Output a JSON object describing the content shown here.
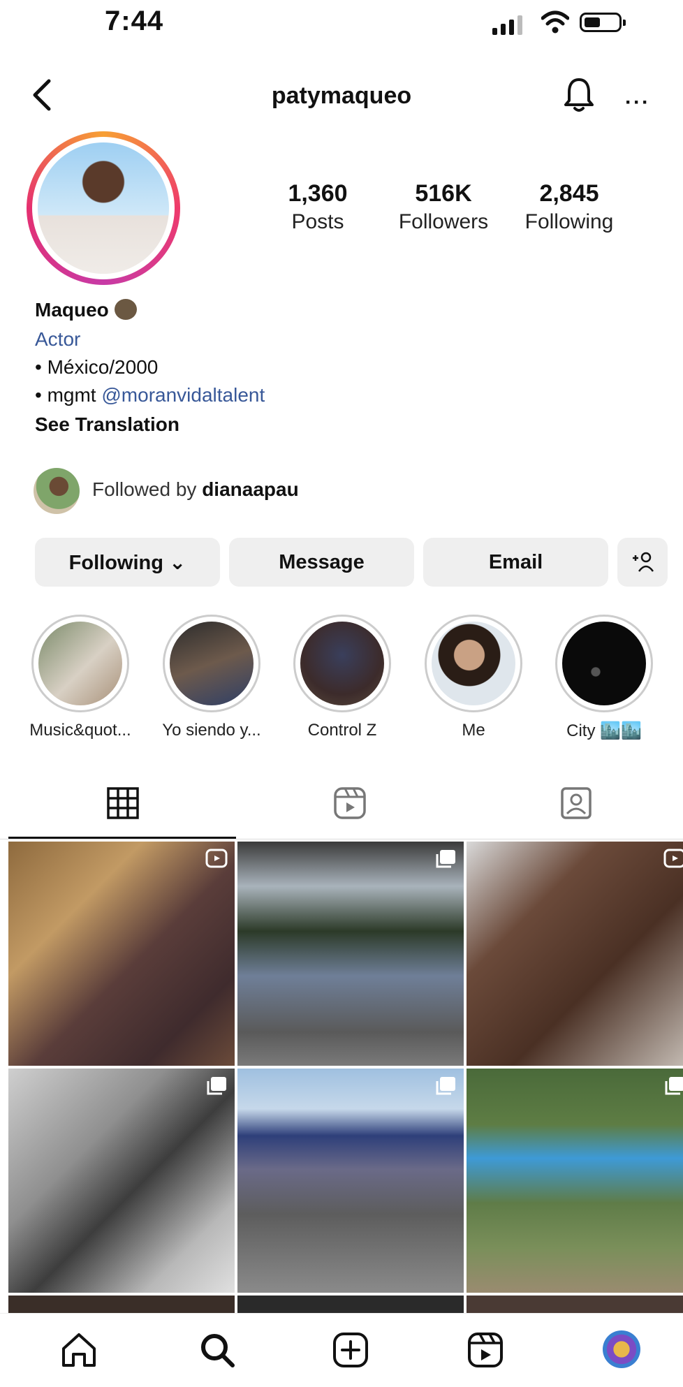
{
  "status_bar": {
    "time": "7:44"
  },
  "header": {
    "username": "patymaqueo",
    "more_label": "···"
  },
  "profile": {
    "stats": [
      {
        "value": "1,360",
        "label": "Posts"
      },
      {
        "value": "516K",
        "label": "Followers"
      },
      {
        "value": "2,845",
        "label": "Following"
      }
    ],
    "name": "Maqueo",
    "category": "Actor",
    "bio_line1": "• México/2000",
    "bio_line2_prefix": "• mgmt ",
    "bio_line2_mention": "@moranvidaltalent",
    "see_translation": "See Translation",
    "followed_prefix": "Followed by ",
    "followed_user": "dianaapau"
  },
  "actions": {
    "following": "Following ⌄",
    "message": "Message",
    "email": "Email"
  },
  "highlights": [
    {
      "label": "Music&quot..."
    },
    {
      "label": "Yo siendo y..."
    },
    {
      "label": "Control Z"
    },
    {
      "label": "Me"
    },
    {
      "label": "City 🏙️🏙️"
    }
  ],
  "icons": {
    "back": "chevron-left-icon",
    "bell": "bell-icon",
    "grid_tab": "grid-icon",
    "reels_tab": "reels-icon",
    "tagged_tab": "tagged-icon",
    "home": "home-icon",
    "search": "search-icon",
    "create": "create-icon",
    "reels": "reels-icon",
    "profile": "profile-avatar"
  },
  "colors": {
    "link": "#385898",
    "button_bg": "#efefef",
    "ring_gradient": "#ee3a6b"
  }
}
